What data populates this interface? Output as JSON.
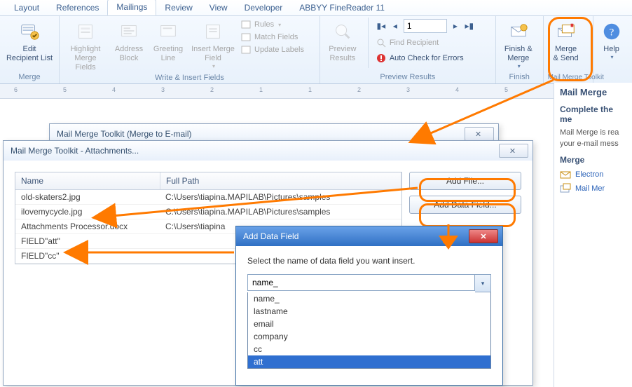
{
  "tabs": {
    "layout": "Layout",
    "references": "References",
    "mailings": "Mailings",
    "review": "Review",
    "view": "View",
    "developer": "Developer",
    "abbyy": "ABBYY FineReader 11"
  },
  "ribbon": {
    "merge_group": "Merge",
    "edit_recipient": "Edit\nRecipient List",
    "highlight": "Highlight\nMerge Fields",
    "address": "Address\nBlock",
    "greeting": "Greeting\nLine",
    "insert_field": "Insert Merge\nField",
    "rules": "Rules",
    "match": "Match Fields",
    "update": "Update Labels",
    "write_group": "Write & Insert Fields",
    "preview_btn": "Preview\nResults",
    "record": "1",
    "find": "Find Recipient",
    "autocheck": "Auto Check for Errors",
    "preview_group": "Preview Results",
    "finish": "Finish &\nMerge",
    "finish_group": "Finish",
    "merge_send": "Merge\n& Send",
    "mmt_group": "Mail Merge Toolkit",
    "help": "Help"
  },
  "taskpane": {
    "title": "Mail Merge",
    "heading": "Complete the me",
    "para1": "Mail Merge is rea",
    "para2": "your e-mail mess",
    "section": "Merge",
    "link1": "Electron",
    "link2": "Mail Mer"
  },
  "dlg1_title": "Mail Merge Toolkit (Merge to E-mail)",
  "dlg2_title": "Mail Merge Toolkit - Attachments...",
  "attachments": {
    "hdr_name": "Name",
    "hdr_path": "Full Path",
    "rows": [
      {
        "name": "old-skaters2.jpg",
        "path": "C:\\Users\\tiapina.MAPILAB\\Pictures\\samples"
      },
      {
        "name": "ilovemycycle.jpg",
        "path": "C:\\Users\\tiapina.MAPILAB\\Pictures\\samples"
      },
      {
        "name": "Attachments Processor.docx",
        "path": "C:\\Users\\tiapina"
      },
      {
        "name": "FIELD\"att\"",
        "path": ""
      },
      {
        "name": "FIELD\"cc\"",
        "path": ""
      }
    ],
    "add_file": "Add File...",
    "add_field": "Add Data Field..."
  },
  "dlg3": {
    "title": "Add Data Field",
    "prompt": "Select the name of data field you want insert.",
    "value": "name_",
    "options": [
      "name_",
      "lastname",
      "email",
      "company",
      "cc",
      "att"
    ],
    "selected": "att"
  },
  "ruler_marks": [
    "6",
    "5",
    "4",
    "3",
    "2",
    "1",
    "1",
    "2",
    "3",
    "4",
    "5"
  ]
}
